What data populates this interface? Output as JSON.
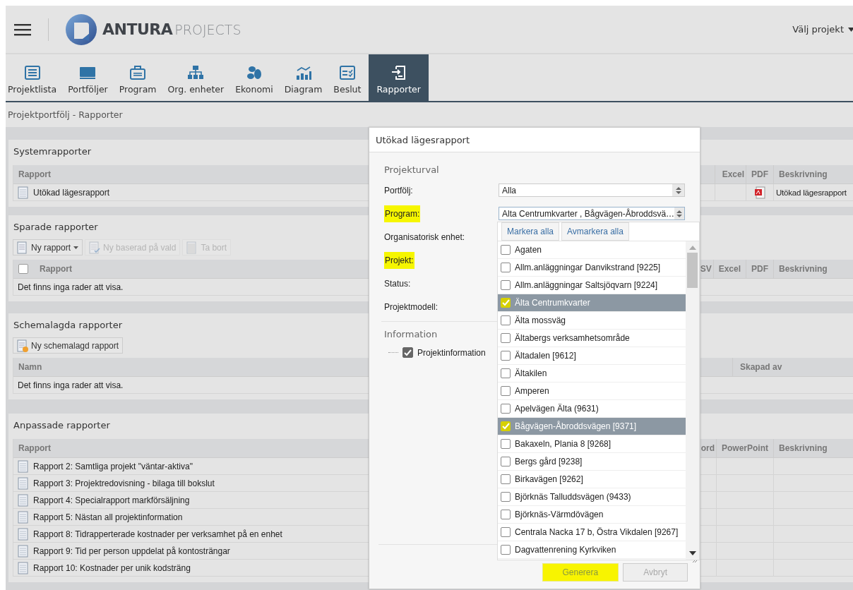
{
  "header": {
    "logo_bold": "ANTURA",
    "logo_light": "PROJECTS",
    "project_picker": "Välj projekt"
  },
  "nav": [
    {
      "label": "Projektlista",
      "kind": "list",
      "selected": false
    },
    {
      "label": "Portföljer",
      "kind": "portfolio",
      "selected": false
    },
    {
      "label": "Program",
      "kind": "briefcase",
      "selected": false
    },
    {
      "label": "Org. enheter",
      "kind": "org",
      "selected": false
    },
    {
      "label": "Ekonomi",
      "kind": "coins",
      "selected": false
    },
    {
      "label": "Diagram",
      "kind": "chart",
      "selected": false
    },
    {
      "label": "Beslut",
      "kind": "decision",
      "selected": false
    },
    {
      "label": "Rapporter",
      "kind": "report",
      "selected": true
    }
  ],
  "breadcrumb": "Projektportfölj - Rapporter",
  "sections": [
    {
      "title": "Systemrapporter",
      "columns_left": [
        "Rapport"
      ],
      "columns_right": [
        "Excel",
        "PDF",
        "Beskrivning"
      ],
      "rows": [
        {
          "name": "Utökad lägesrapport",
          "pdf": true,
          "description": "Utökad lägesrapport"
        }
      ]
    },
    {
      "title": "Sparade rapporter",
      "toolbar": [
        {
          "label": "Ny rapport",
          "kind": "new",
          "dropdown": true,
          "disabled": false
        },
        {
          "label": "Ny baserad på vald",
          "kind": "copy",
          "dropdown": false,
          "disabled": true
        },
        {
          "label": "Ta bort",
          "kind": "delete",
          "dropdown": false,
          "disabled": true
        }
      ],
      "select_all": {
        "checked": false
      },
      "columns_left": [
        "Rapport"
      ],
      "columns_right": [
        "SV",
        "Excel",
        "PDF",
        "Beskrivning"
      ],
      "empty_text": "Det finns inga rader att visa."
    },
    {
      "title": "Schemalagda rapporter",
      "toolbar": [
        {
          "label": "Ny schemalagd rapport",
          "kind": "schedule",
          "dropdown": false,
          "disabled": false
        }
      ],
      "columns_left": [
        "Namn"
      ],
      "columns_right": [
        "Skapad av"
      ],
      "empty_text": "Det finns inga rader att visa."
    },
    {
      "title": "Anpassade rapporter",
      "columns_left": [
        "Rapport"
      ],
      "columns_right": [
        "ord",
        "PowerPoint",
        "Beskrivning"
      ],
      "rows": [
        {
          "name": "Rapport 2: Samtliga projekt \"väntar-aktiva\""
        },
        {
          "name": "Rapport 3: Projektredovisning - bilaga till bokslut"
        },
        {
          "name": "Rapport 4: Specialrapport markförsäljning"
        },
        {
          "name": "Rapport 5: Nästan all projektinformation"
        },
        {
          "name": "Rapport 8: Tidrapperterade kostnader per verksamhet på en enhet"
        },
        {
          "name": "Rapport 9: Tid per person uppdelat på kontosträngar"
        },
        {
          "name": "Rapport 10: Kostnader per unik kodsträng"
        }
      ]
    }
  ],
  "dialog": {
    "title": "Utökad lägesrapport",
    "selection_heading": "Projekturval",
    "fields": [
      {
        "label": "Portfölj:",
        "highlighted": false,
        "value": "Alla"
      },
      {
        "label": "Program:",
        "highlighted": true,
        "value": "Alta Centrumkvarter , Bågvägen-Åbroddsvä…",
        "expanded": true
      },
      {
        "label": "Organisatorisk enhet:",
        "highlighted": false
      },
      {
        "label": "Projekt:",
        "highlighted": true
      },
      {
        "label": "Status:",
        "highlighted": false
      },
      {
        "label": "Projektmodell:",
        "highlighted": false
      }
    ],
    "info_heading": "Information",
    "info_items": [
      {
        "label": "Projektinformation",
        "checked": true
      }
    ],
    "dropdown": {
      "select_all": "Markera alla",
      "deselect_all": "Avmarkera alla",
      "options": [
        {
          "label": "Agaten",
          "checked": false
        },
        {
          "label": "Allm.anläggningar Danvikstrand [9225]",
          "checked": false
        },
        {
          "label": "Allm.anläggningar Saltsjöqvarn [9224]",
          "checked": false
        },
        {
          "label": "Älta Centrumkvarter",
          "checked": true
        },
        {
          "label": "Älta mossväg",
          "checked": false
        },
        {
          "label": "Ältabergs verksamhetsområde",
          "checked": false
        },
        {
          "label": "Ältadalen [9612]",
          "checked": false
        },
        {
          "label": "Ältakilen",
          "checked": false
        },
        {
          "label": "Amperen",
          "checked": false
        },
        {
          "label": "Apelvägen Älta (9631)",
          "checked": false
        },
        {
          "label": "Bågvägen-Åbroddsvägen [9371]",
          "checked": true
        },
        {
          "label": "Bakaxeln, Plania 8 [9268]",
          "checked": false
        },
        {
          "label": "Bergs gård [9238]",
          "checked": false
        },
        {
          "label": "Birkavägen [9262]",
          "checked": false
        },
        {
          "label": "Björknäs Talluddsvägen (9433)",
          "checked": false
        },
        {
          "label": "Björknäs-Värmdövägen",
          "checked": false
        },
        {
          "label": "Centrala Nacka 17 b, Östra Vikdalen [9267]",
          "checked": false
        },
        {
          "label": "Dagvattenrening Kyrkviken",
          "checked": false
        }
      ]
    },
    "buttons": [
      {
        "label": "Generera",
        "highlighted": true,
        "disabled": false
      },
      {
        "label": "Avbryt",
        "highlighted": false,
        "disabled": true
      }
    ]
  }
}
